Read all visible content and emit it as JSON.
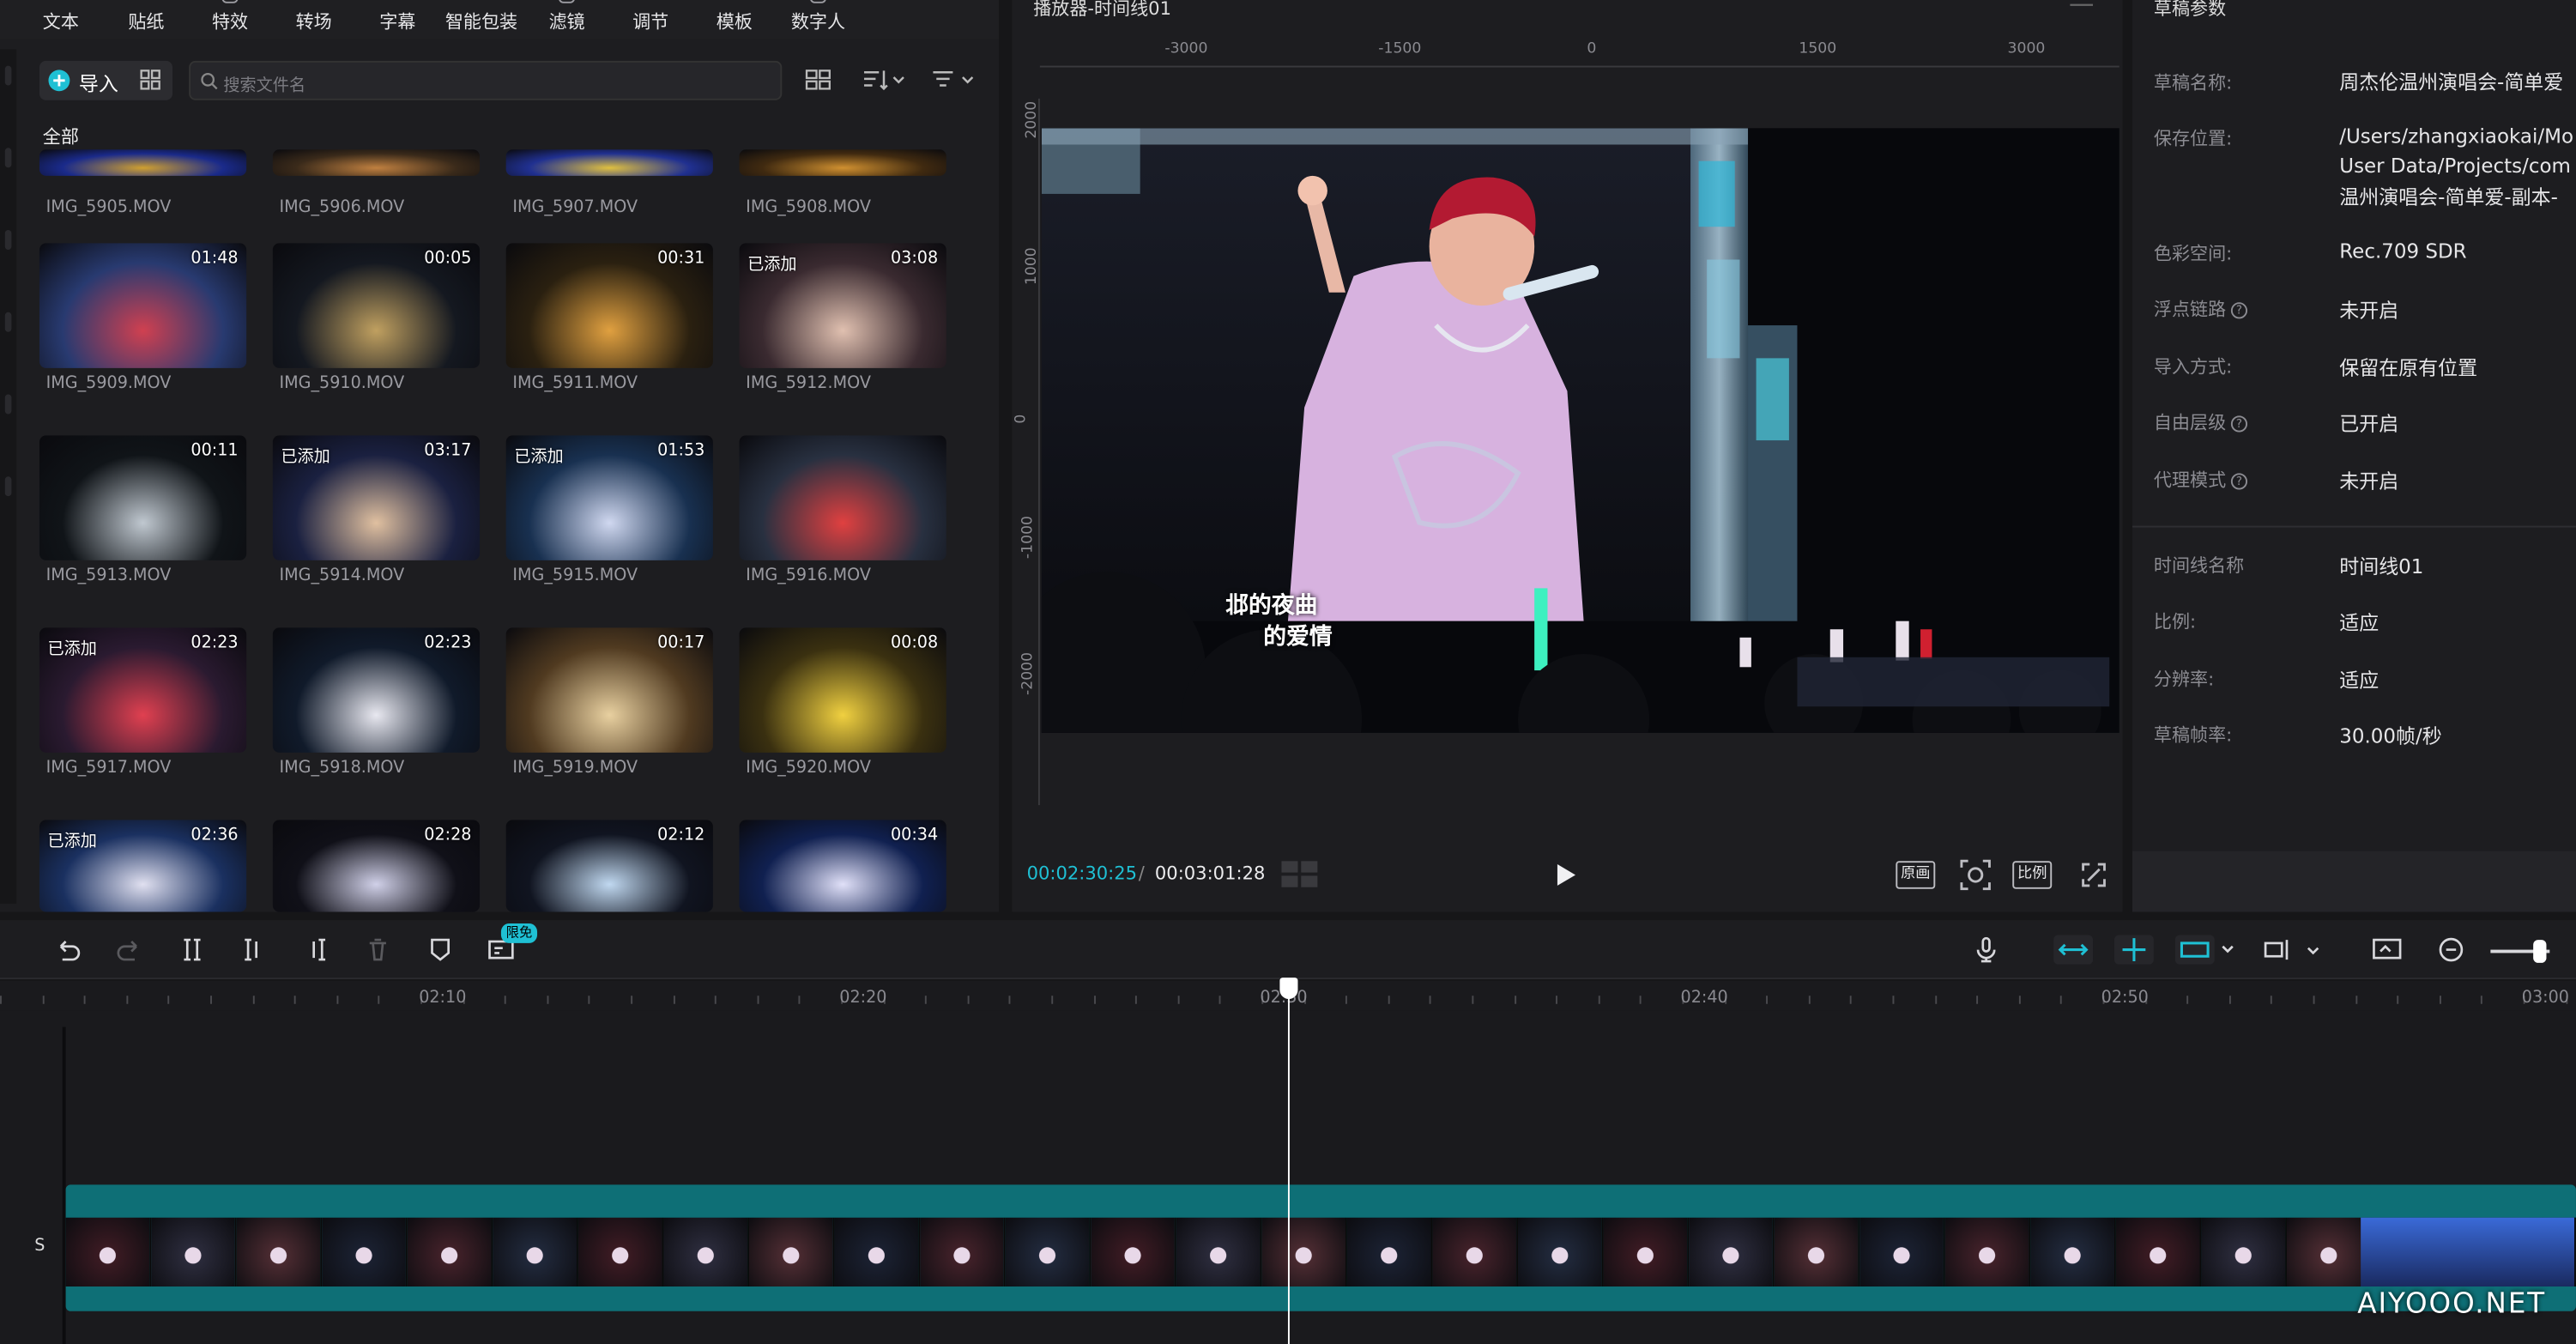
{
  "toolbar": {
    "items": [
      "文本",
      "贴纸",
      "特效",
      "转场",
      "字幕",
      "智能包装",
      "滤镜",
      "调节",
      "模板",
      "数字人"
    ]
  },
  "media": {
    "import_label": "导入",
    "search_placeholder": "搜索文件名",
    "folder_all": "全部",
    "clips": [
      {
        "name": "IMG_5905.MOV",
        "duration": "",
        "added": ""
      },
      {
        "name": "IMG_5906.MOV",
        "duration": "",
        "added": ""
      },
      {
        "name": "IMG_5907.MOV",
        "duration": "",
        "added": ""
      },
      {
        "name": "IMG_5908.MOV",
        "duration": "",
        "added": ""
      },
      {
        "name": "IMG_5909.MOV",
        "duration": "01:48",
        "added": ""
      },
      {
        "name": "IMG_5910.MOV",
        "duration": "00:05",
        "added": ""
      },
      {
        "name": "IMG_5911.MOV",
        "duration": "00:31",
        "added": ""
      },
      {
        "name": "IMG_5912.MOV",
        "duration": "03:08",
        "added": "已添加"
      },
      {
        "name": "IMG_5913.MOV",
        "duration": "00:11",
        "added": ""
      },
      {
        "name": "IMG_5914.MOV",
        "duration": "03:17",
        "added": "已添加"
      },
      {
        "name": "IMG_5915.MOV",
        "duration": "01:53",
        "added": "已添加"
      },
      {
        "name": "IMG_5916.MOV",
        "duration": "",
        "added": ""
      },
      {
        "name": "IMG_5917.MOV",
        "duration": "02:23",
        "added": "已添加"
      },
      {
        "name": "IMG_5918.MOV",
        "duration": "02:23",
        "added": ""
      },
      {
        "name": "IMG_5919.MOV",
        "duration": "00:17",
        "added": ""
      },
      {
        "name": "IMG_5920.MOV",
        "duration": "00:08",
        "added": ""
      },
      {
        "name": "",
        "duration": "02:36",
        "added": "已添加"
      },
      {
        "name": "",
        "duration": "02:28",
        "added": ""
      },
      {
        "name": "",
        "duration": "02:12",
        "added": ""
      },
      {
        "name": "",
        "duration": "00:34",
        "added": ""
      }
    ]
  },
  "player": {
    "title": "播放器-时间线01",
    "ruler_h": [
      "-3000",
      "-1500",
      "0",
      "1500",
      "3000"
    ],
    "ruler_v": [
      "2000",
      "1000",
      "0",
      "-1000",
      "-2000"
    ],
    "subtitle_line1": "邶的夜曲",
    "subtitle_line2": "的爱情",
    "current_time": "00:02:30:25",
    "separator": "/",
    "total_time": "00:03:01:28",
    "btn_original": "原画",
    "btn_ratio": "比例"
  },
  "properties": {
    "title": "草稿参数",
    "rows": [
      {
        "key": "草稿名称:",
        "value": "周杰伦温州演唱会-简单爱"
      },
      {
        "key": "保存位置:",
        "value": "/Users/zhangxiaokai/Mo",
        "value2": "User Data/Projects/com",
        "value3": "温州演唱会-简单爱-副本-"
      },
      {
        "key": "色彩空间:",
        "value": "Rec.709 SDR"
      },
      {
        "key": "浮点链路",
        "value": "未开启"
      },
      {
        "key": "导入方式:",
        "value": "保留在原有位置"
      },
      {
        "key": "自由层级",
        "value": "已开启"
      },
      {
        "key": "代理模式",
        "value": "未开启"
      },
      {
        "key": "时间线名称",
        "value": "时间线01"
      },
      {
        "key": "比例:",
        "value": "适应"
      },
      {
        "key": "分辨率:",
        "value": "适应"
      },
      {
        "key": "草稿帧率:",
        "value": "30.00帧/秒"
      }
    ]
  },
  "timeline": {
    "badge": "限免",
    "ruler": [
      "02:10",
      "02:20",
      "02:30",
      "02:40",
      "02:50",
      "03:00"
    ],
    "track_label": "S"
  },
  "watermark": "AIYOOO.NET",
  "colors": {
    "accent": "#1fc0d4",
    "track": "#0e6f76",
    "panel": "#1d1d20"
  }
}
